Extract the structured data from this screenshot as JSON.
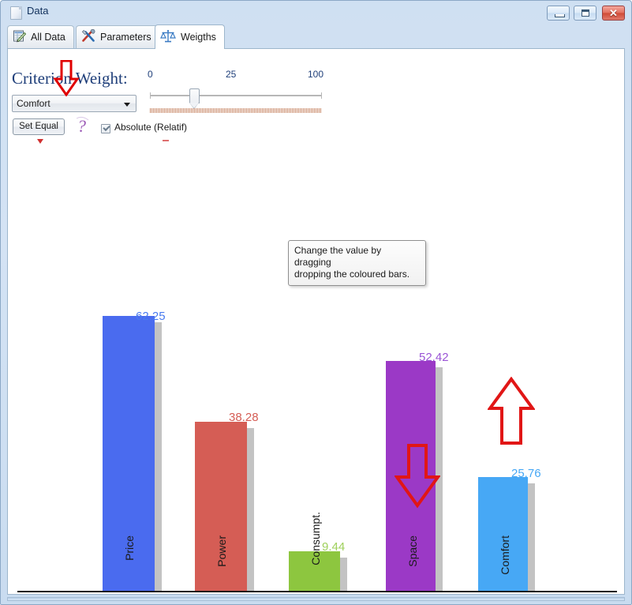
{
  "window": {
    "title": "Data",
    "icon": "document-icon",
    "buttons": {
      "minimize": "minimize-icon",
      "maximize": "maximize-icon",
      "close": "✕"
    }
  },
  "tabs": [
    {
      "label": "All Data",
      "icon": "spreadsheet-pencil-icon",
      "active": false
    },
    {
      "label": "Parameters",
      "icon": "tools-icon",
      "active": false
    },
    {
      "label": "Weigths",
      "icon": "balance-scale-icon",
      "active": true
    }
  ],
  "controls": {
    "criterion_label": "Criterion Weight:",
    "criterion_select": {
      "value": "Comfort",
      "caret": "chevron-down-icon"
    },
    "set_equal_label": "Set Equal",
    "help_icon": "question-mark-icon",
    "absolute_checkbox": {
      "label": "Absolute (Relatif)",
      "checked": true
    }
  },
  "slider": {
    "ticks": [
      {
        "label": "0",
        "x": 5
      },
      {
        "label": "25",
        "x": 104
      },
      {
        "label": "100",
        "x": 208
      }
    ],
    "thumb_position": 58,
    "min": 0,
    "max": 100
  },
  "tooltip": {
    "line1": "Change the value by dragging",
    "line2": "dropping the coloured bars."
  },
  "chart_data": {
    "type": "bar",
    "title": "",
    "xlabel": "",
    "ylabel": "",
    "categories": [
      "Price",
      "Power",
      "Consumpt.",
      "Space",
      "Comfort"
    ],
    "values": [
      62.25,
      38.28,
      9.44,
      52.42,
      25.76
    ],
    "value_labels": [
      "62.25",
      "38.28",
      "9.44",
      "52.42",
      "25.76"
    ],
    "colors": [
      "#4a6bef",
      "#d55d55",
      "#8dc63f",
      "#9b39c6",
      "#47a8f5"
    ],
    "shadow_color": "#c3c3c3",
    "ylim": [
      0,
      100
    ],
    "grid": false,
    "legend": "none"
  },
  "annotations": {
    "arrow_down_criterion": "red-down-arrow",
    "arrow_down_space": "red-down-arrow",
    "arrow_up_comfort": "red-up-arrow"
  }
}
